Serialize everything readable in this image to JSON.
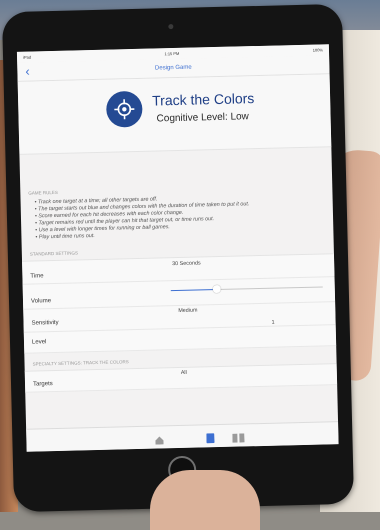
{
  "status_bar": {
    "left": "iPad",
    "time": "1:15 PM",
    "right": "100%"
  },
  "nav": {
    "title": "Design Game"
  },
  "header": {
    "title": "Track the Colors",
    "level": "Cognitive Level: Low"
  },
  "rules": {
    "header": "GAME RULES",
    "items": [
      "Track one target at a time; all other targets are off.",
      "The target starts out blue and changes colors with the duration of time taken to put it out.",
      "Score earned for each hit decreases with each color change.",
      "Target remains red until the player can hit that target out, or time runs out.",
      "Use a level with longer times for running or ball games.",
      "Play until time runs out."
    ]
  },
  "standard_settings": {
    "header": "STANDARD SETTINGS",
    "time": {
      "label": "Time",
      "value": "30 Seconds"
    },
    "volume": {
      "label": "Volume",
      "level": 0.3
    },
    "sensitivity": {
      "label": "Sensitivity",
      "value": "Medium"
    },
    "level": {
      "label": "Level",
      "value": "1"
    }
  },
  "specialty_settings": {
    "header": "SPECIALTY SETTINGS: TRACK THE COLORS",
    "targets": {
      "label": "Targets",
      "value": "All"
    }
  },
  "colors": {
    "accent": "#3d6fd1",
    "icon_bg": "#244a93",
    "title": "#1f3f86"
  }
}
